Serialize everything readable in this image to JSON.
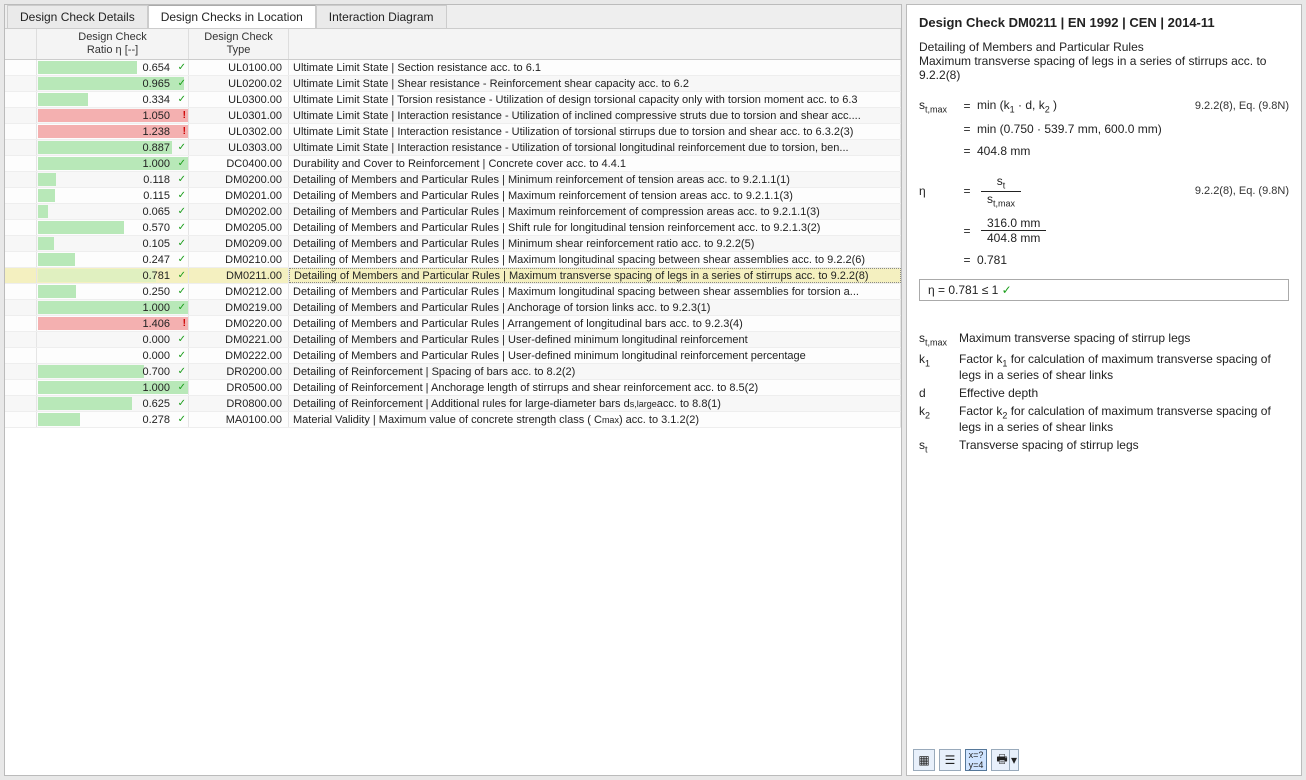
{
  "tabs": {
    "t0": "Design Check Details",
    "t1": "Design Checks in Location",
    "t2": "Interaction Diagram",
    "activeIndex": 1
  },
  "columns": {
    "c1a": "Design Check",
    "c1b": "Ratio η [--]",
    "c2a": "Design Check",
    "c2b": "Type"
  },
  "rows": [
    {
      "ratio": "0.654",
      "ok": true,
      "type": "UL0100.00",
      "desc": "Ultimate Limit State | Section resistance acc. to 6.1"
    },
    {
      "ratio": "0.965",
      "ok": true,
      "type": "UL0200.02",
      "desc": "Ultimate Limit State | Shear resistance - Reinforcement shear capacity acc. to 6.2"
    },
    {
      "ratio": "0.334",
      "ok": true,
      "type": "UL0300.00",
      "desc": "Ultimate Limit State | Torsion resistance - Utilization of design torsional capacity only with torsion moment acc. to 6.3"
    },
    {
      "ratio": "1.050",
      "ok": false,
      "type": "UL0301.00",
      "desc": "Ultimate Limit State | Interaction resistance - Utilization of inclined compressive struts due to torsion and shear acc...."
    },
    {
      "ratio": "1.238",
      "ok": false,
      "type": "UL0302.00",
      "desc": "Ultimate Limit State | Interaction resistance - Utilization of torsional stirrups due to torsion and shear acc. to 6.3.2(3)"
    },
    {
      "ratio": "0.887",
      "ok": true,
      "type": "UL0303.00",
      "desc": "Ultimate Limit State | Interaction resistance - Utilization of torsional longitudinal reinforcement due to torsion, ben..."
    },
    {
      "ratio": "1.000",
      "ok": true,
      "type": "DC0400.00",
      "desc": "Durability and Cover to Reinforcement | Concrete cover acc. to 4.4.1"
    },
    {
      "ratio": "0.118",
      "ok": true,
      "type": "DM0200.00",
      "desc": "Detailing of Members and Particular Rules | Minimum reinforcement of tension areas acc. to 9.2.1.1(1)"
    },
    {
      "ratio": "0.115",
      "ok": true,
      "type": "DM0201.00",
      "desc": "Detailing of Members and Particular Rules | Maximum reinforcement of tension areas acc. to 9.2.1.1(3)"
    },
    {
      "ratio": "0.065",
      "ok": true,
      "type": "DM0202.00",
      "desc": "Detailing of Members and Particular Rules | Maximum reinforcement of compression areas acc. to 9.2.1.1(3)"
    },
    {
      "ratio": "0.570",
      "ok": true,
      "type": "DM0205.00",
      "desc": "Detailing of Members and Particular Rules | Shift rule for longitudinal tension reinforcement acc. to 9.2.1.3(2)"
    },
    {
      "ratio": "0.105",
      "ok": true,
      "type": "DM0209.00",
      "desc": "Detailing of Members and Particular Rules | Minimum shear reinforcement ratio acc. to 9.2.2(5)"
    },
    {
      "ratio": "0.247",
      "ok": true,
      "type": "DM0210.00",
      "desc": "Detailing of Members and Particular Rules | Maximum longitudinal spacing between shear assemblies acc. to 9.2.2(6)"
    },
    {
      "ratio": "0.781",
      "ok": true,
      "type": "DM0211.00",
      "desc": "Detailing of Members and Particular Rules | Maximum transverse spacing of legs in a series of stirrups acc. to 9.2.2(8)",
      "selected": true
    },
    {
      "ratio": "0.250",
      "ok": true,
      "type": "DM0212.00",
      "desc": "Detailing of Members and Particular Rules | Maximum longitudinal spacing between shear assemblies for torsion a..."
    },
    {
      "ratio": "1.000",
      "ok": true,
      "type": "DM0219.00",
      "desc": "Detailing of Members and Particular Rules | Anchorage of torsion links acc. to 9.2.3(1)"
    },
    {
      "ratio": "1.406",
      "ok": false,
      "type": "DM0220.00",
      "desc": "Detailing of Members and Particular Rules | Arrangement of longitudinal bars acc. to 9.2.3(4)"
    },
    {
      "ratio": "0.000",
      "ok": true,
      "type": "DM0221.00",
      "desc": "Detailing of Members and Particular Rules | User-defined minimum longitudinal reinforcement"
    },
    {
      "ratio": "0.000",
      "ok": true,
      "type": "DM0222.00",
      "desc": "Detailing of Members and Particular Rules | User-defined minimum longitudinal reinforcement percentage"
    },
    {
      "ratio": "0.700",
      "ok": true,
      "type": "DR0200.00",
      "desc": "Detailing of Reinforcement | Spacing of bars acc. to 8.2(2)"
    },
    {
      "ratio": "1.000",
      "ok": true,
      "type": "DR0500.00",
      "desc": "Detailing of Reinforcement | Anchorage length of stirrups and shear reinforcement acc. to 8.5(2)"
    },
    {
      "ratio": "0.625",
      "ok": true,
      "type": "DR0800.00",
      "desc": "Detailing of Reinforcement | Additional rules for large-diameter bars d<sub>s,large</sub> acc. to 8.8(1)"
    },
    {
      "ratio": "0.278",
      "ok": true,
      "type": "MA0100.00",
      "desc": "Material Validity | Maximum value of concrete strength class ( C<sub>max</sub> ) acc. to 3.1.2(2)"
    }
  ],
  "detail": {
    "title": "Design Check DM0211 | EN 1992 | CEN | 2014-11",
    "sub1": "Detailing of Members and Particular Rules",
    "sub2": "Maximum transverse spacing of legs in a series of stirrups acc. to 9.2.2(8)",
    "ref1": "9.2.2(8), Eq. (9.8N)",
    "eq1_lhs": "s<sub>t,max</sub>",
    "eq1_r1": "min (k<sub>1</sub> · d,  k<sub>2</sub> )",
    "eq1_r2": "min (0.750  ·  539.7 mm,  600.0 mm)",
    "eq1_r3": "404.8 mm",
    "eq2_lhs": "η",
    "eq2_frac_num": "s<sub>t</sub>",
    "eq2_frac_den": "s<sub>t,max</sub>",
    "eq2_frac2_num": "316.0 mm",
    "eq2_frac2_den": "404.8 mm",
    "eq2_r3": "0.781",
    "result": "η   =   0.781  ≤ 1",
    "glossary": [
      {
        "sym": "s<sub>t,max</sub>",
        "txt": "Maximum transverse spacing of stirrup legs"
      },
      {
        "sym": "k<sub>1</sub>",
        "txt": "Factor k<sub>1</sub> for calculation of maximum transverse spacing of legs in a series of shear links"
      },
      {
        "sym": "d",
        "txt": "Effective depth"
      },
      {
        "sym": "k<sub>2</sub>",
        "txt": "Factor k<sub>2</sub> for calculation of maximum transverse spacing of legs in a series of shear links"
      },
      {
        "sym": "s<sub>t</sub>",
        "txt": "Transverse spacing of stirrup legs"
      }
    ]
  },
  "toolbar": {
    "btn1": "layout",
    "btn2": "list",
    "btn3": "formula",
    "btn4": "print"
  }
}
